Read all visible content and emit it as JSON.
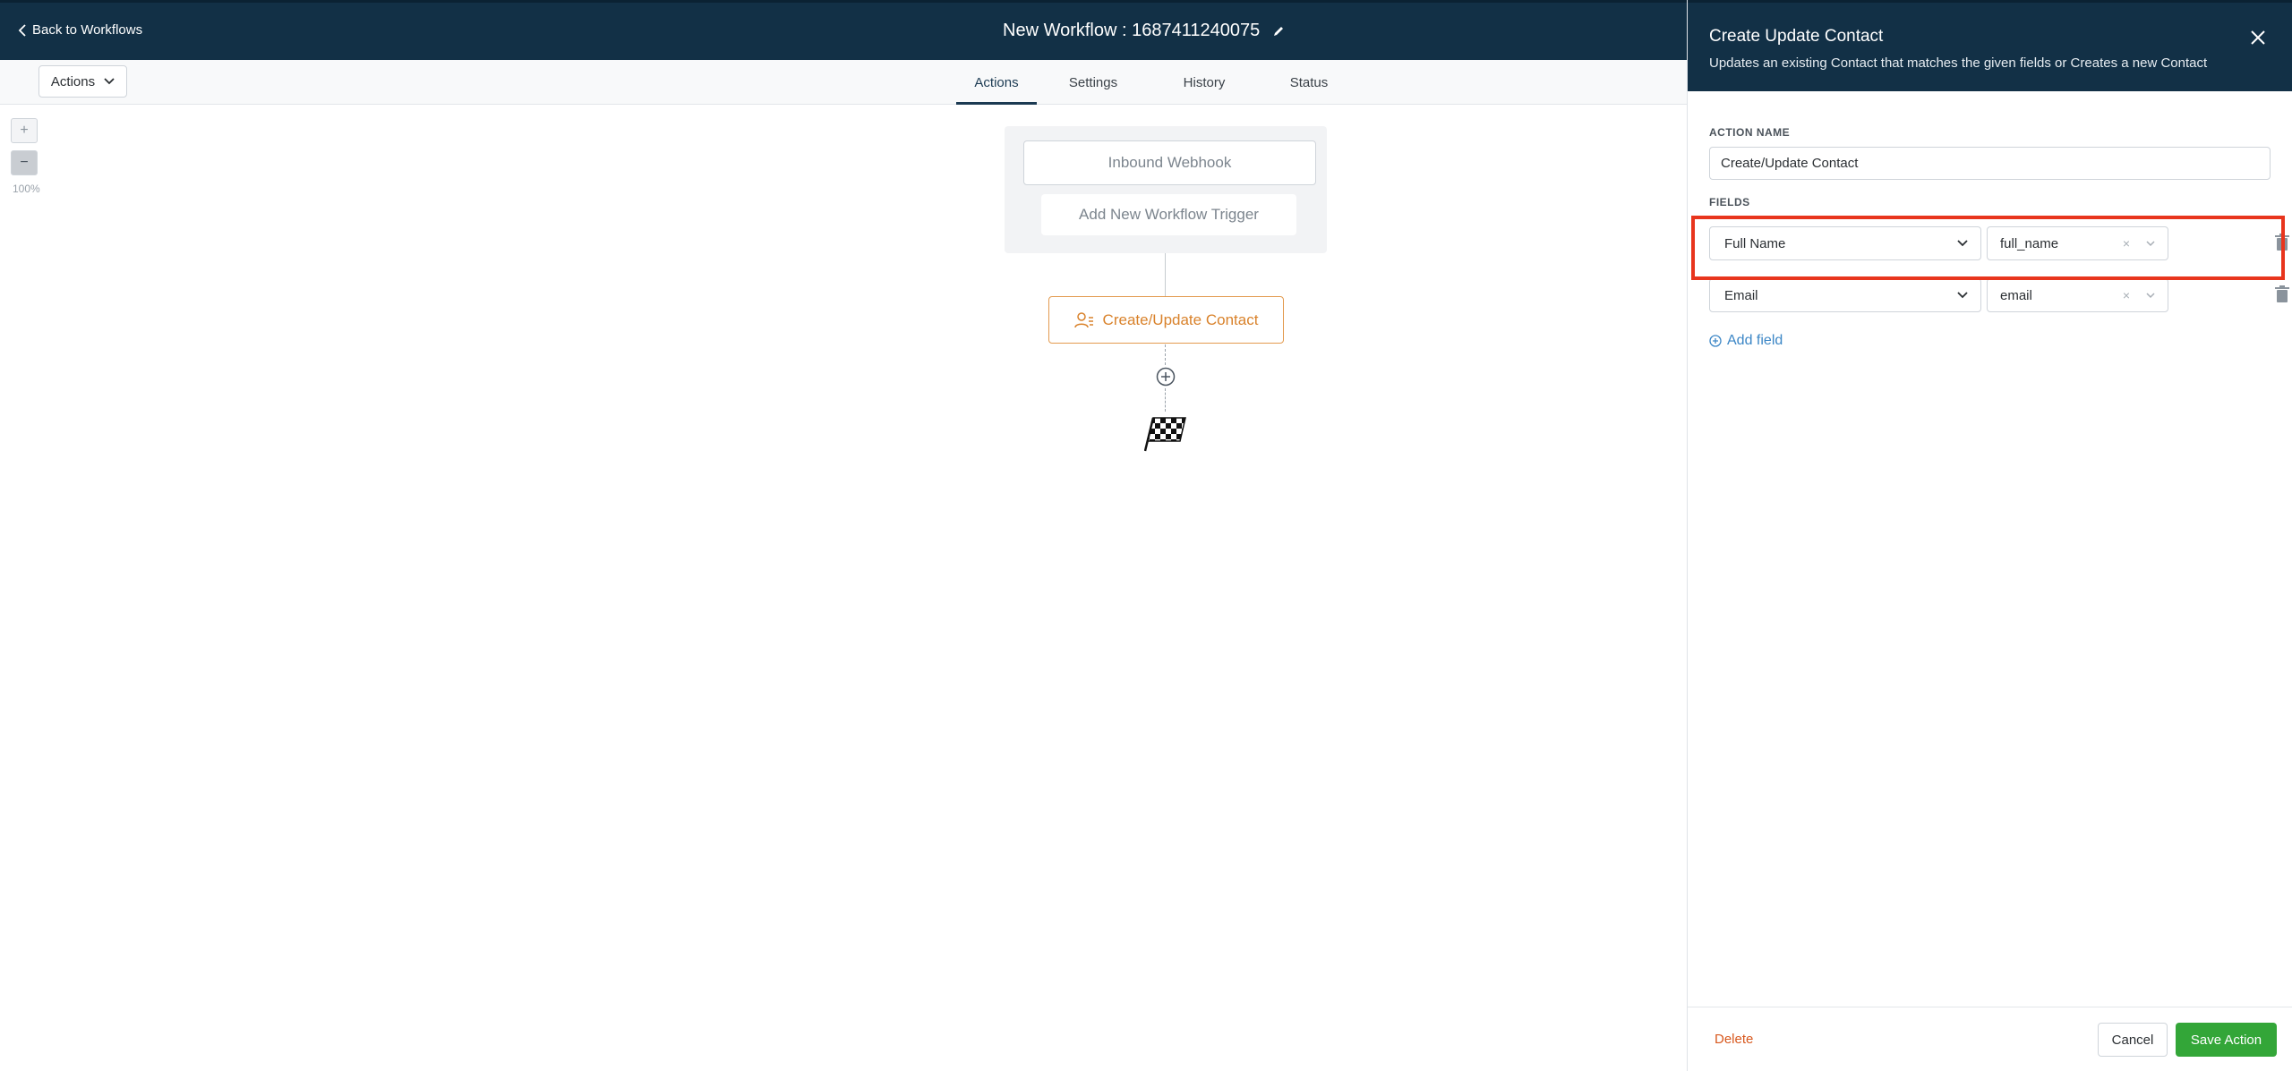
{
  "header": {
    "back_label": "Back to Workflows",
    "workflow_title": "New Workflow : 1687411240075"
  },
  "toolbar": {
    "actions_dropdown": "Actions",
    "tabs": [
      {
        "label": "Actions",
        "active": true
      },
      {
        "label": "Settings",
        "active": false
      },
      {
        "label": "History",
        "active": false
      },
      {
        "label": "Status",
        "active": false
      }
    ]
  },
  "canvas": {
    "zoom_in": "+",
    "zoom_out": "−",
    "zoom_level": "100%",
    "trigger_label": "Inbound Webhook",
    "add_trigger_label": "Add New Workflow Trigger",
    "action_node_label": "Create/Update Contact"
  },
  "panel": {
    "title": "Create Update Contact",
    "subtitle": "Updates an existing Contact that matches the given fields or Creates a new Contact",
    "action_name_label": "ACTION NAME",
    "action_name_value": "Create/Update Contact",
    "fields_label": "FIELDS",
    "fields": [
      {
        "field": "Full Name",
        "value": "full_name",
        "clear": "×"
      },
      {
        "field": "Email",
        "value": "email",
        "clear": "×"
      }
    ],
    "add_field_label": "Add field",
    "delete_label": "Delete",
    "cancel_label": "Cancel",
    "save_label": "Save Action"
  },
  "colors": {
    "header_bg": "#123046",
    "accent_orange": "#d9822b",
    "save_green": "#33a638",
    "delete_orange": "#d8591f",
    "link_blue": "#3b86c6",
    "highlight_red": "#e8351d"
  }
}
